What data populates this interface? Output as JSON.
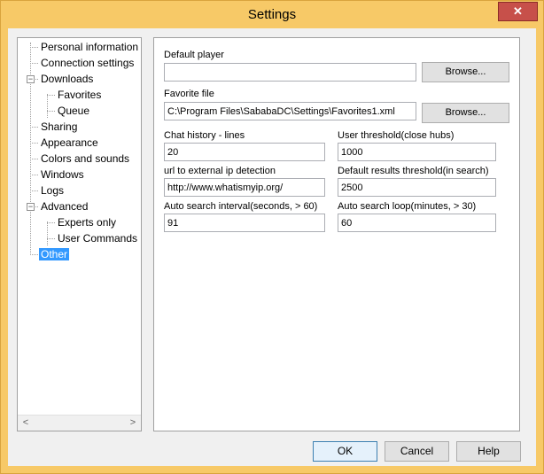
{
  "window": {
    "title": "Settings",
    "close_glyph": "✕"
  },
  "tree": {
    "items": [
      {
        "label": "Personal information",
        "level": 1
      },
      {
        "label": "Connection settings",
        "level": 1
      },
      {
        "label": "Downloads",
        "level": 1,
        "expander": "−"
      },
      {
        "label": "Favorites",
        "level": 2
      },
      {
        "label": "Queue",
        "level": 2
      },
      {
        "label": "Sharing",
        "level": 1
      },
      {
        "label": "Appearance",
        "level": 1
      },
      {
        "label": "Colors and sounds",
        "level": 1
      },
      {
        "label": "Windows",
        "level": 1
      },
      {
        "label": "Logs",
        "level": 1
      },
      {
        "label": "Advanced",
        "level": 1,
        "expander": "−"
      },
      {
        "label": "Experts only",
        "level": 2
      },
      {
        "label": "User Commands",
        "level": 2
      },
      {
        "label": "Other",
        "level": 1,
        "selected": true
      }
    ],
    "scroll_left_glyph": "<",
    "scroll_right_glyph": ">"
  },
  "panel": {
    "default_player_label": "Default player",
    "default_player_value": "",
    "browse1_label": "Browse...",
    "favorite_file_label": "Favorite file",
    "favorite_file_value": "C:\\Program Files\\SababaDC\\Settings\\Favorites1.xml",
    "browse2_label": "Browse...",
    "chat_history_label": "Chat history - lines",
    "chat_history_value": "20",
    "user_threshold_label": "User threshold(close hubs)",
    "user_threshold_value": "1000",
    "url_ip_label": "url to external ip detection",
    "url_ip_value": "http://www.whatismyip.org/",
    "default_results_label": "Default results threshold(in search)",
    "default_results_value": "2500",
    "auto_search_interval_label": "Auto search interval(seconds, > 60)",
    "auto_search_interval_value": "91",
    "auto_search_loop_label": "Auto search loop(minutes, > 30)",
    "auto_search_loop_value": "60"
  },
  "footer": {
    "ok_label": "OK",
    "cancel_label": "Cancel",
    "help_label": "Help"
  }
}
